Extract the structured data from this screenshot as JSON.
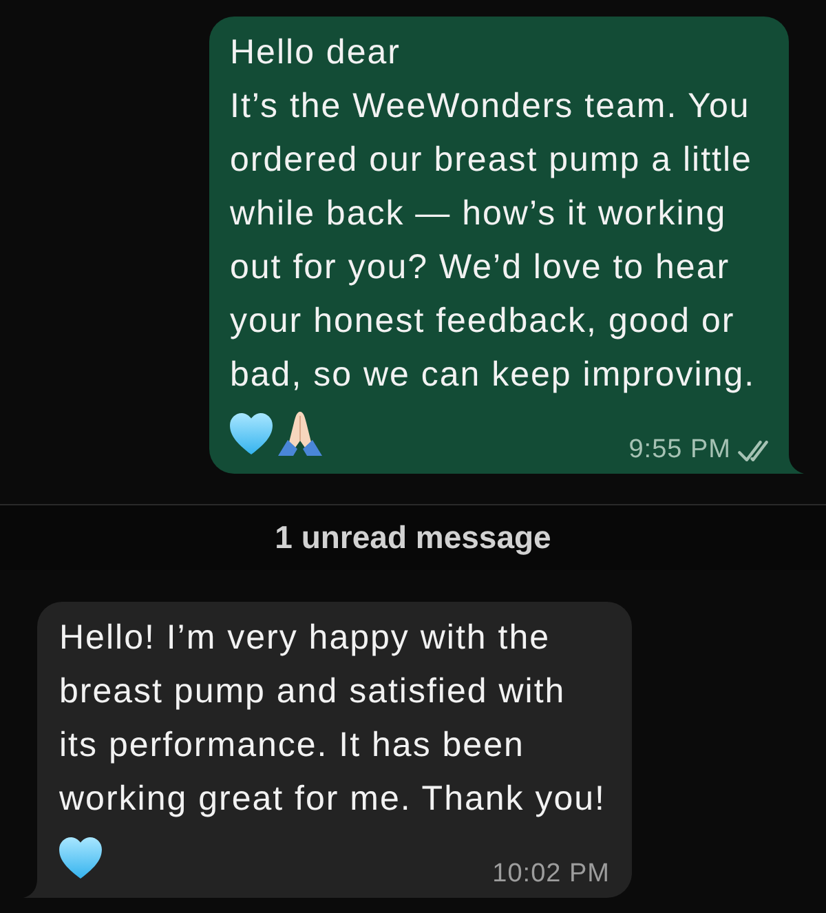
{
  "chat": [
    {
      "kind": "outgoing",
      "text": "Hello dear\nIt’s the WeeWonders team. You ordered our breast pump a little while back — how’s it working out for you? We’d love to hear your honest feedback, good or bad, so we can keep improving.",
      "emojis": [
        {
          "kind": "heart"
        },
        {
          "kind": "folded-hands"
        }
      ],
      "time": "9:55 PM",
      "delivered": true,
      "read": false
    },
    {
      "kind": "divider",
      "label": "1 unread message"
    },
    {
      "kind": "incoming",
      "text": "Hello! I’m very happy with the breast pump and satisfied with its performance. It has been working great for me. Thank you!",
      "emojis": [
        {
          "kind": "heart"
        }
      ],
      "time": "10:02 PM"
    }
  ]
}
